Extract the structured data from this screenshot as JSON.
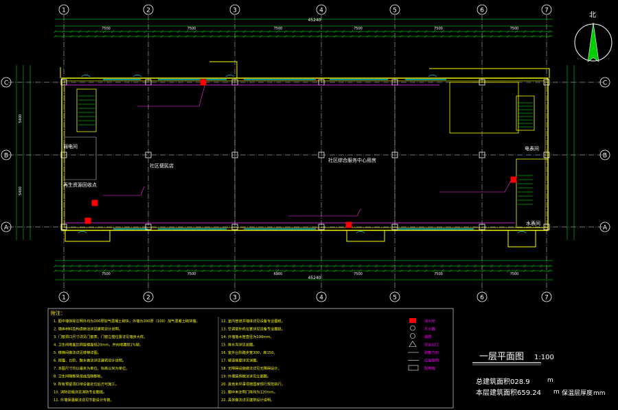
{
  "drawing": {
    "axis_numbers": [
      "1",
      "2",
      "3",
      "4",
      "5",
      "6",
      "7"
    ],
    "axis_letters": [
      "A",
      "B",
      "C"
    ],
    "north_label": "北",
    "total_width_dim": "45240",
    "top_dims": [
      "7500",
      "7500",
      "7500",
      "7500",
      "7500",
      "7500"
    ],
    "bottom_dims": [
      "7500",
      "7500",
      "6900",
      "7500",
      "7500",
      "7500"
    ],
    "left_dims": [
      "5400",
      "5400"
    ],
    "rooms": {
      "store": "社区便民店",
      "service_center": "社区综合服务中心用房",
      "well_room": "弱电间",
      "recycle_point": "再生资源回收点",
      "electric_room": "电表间",
      "meter_room": "水表间"
    }
  },
  "notes": {
    "header": "附注：",
    "left_column": [
      "1. 图中墙体除注明外均为200厚加气混凝土砌块，外墙为200厚（100）加气混凝土砌块墙。",
      "2. 墙体材料及构造做法详见建筑设计说明。",
      "3. 门窗洞口尺寸详见门窗表，门窗立樘位置详见墙身大样。",
      "4. 卫生间地面比同层楼面低20mm，并向地漏找1%坡。",
      "5. 楼梯间做法详见楼梯详图。",
      "6. 雨篷、台阶、散水做法详见建筑设计说明。",
      "7. 本图尺寸均以毫米为单位，标高以米为单位。",
      "8. 卫生间隔断采用成品隔断板。",
      "9. 所有预留洞口待设备定位后方可施工。",
      "10. 消防设施详见消防专业图纸。",
      "11. 外墙保温做法详见节能设计专篇。"
    ],
    "right_column": [
      "12. 室内管道井墙体详见设备专业图纸。",
      "13. 空调室外机位置详见设备专业图纸。",
      "14. 外墙落水管直径为100mm。",
      "15. 排水沟详见总图。",
      "16. 室外台阶踏步宽300，高150。",
      "17. 坡道坡度详见详图。",
      "18. 无障碍设施做法详见无障碍设计。",
      "19. 外墙装饰做法详见立面图。",
      "20. 其他未尽事项按国家现行规范执行。",
      "21. 图中未注明门垛均为120mm。",
      "22. 具体做法详见建筑设计说明。"
    ]
  },
  "legend": [
    {
      "symbol": "red-box",
      "label": "消火栓"
    },
    {
      "symbol": "fire-ext",
      "label": "灭火器"
    },
    {
      "symbol": "smoke",
      "label": "烟感"
    },
    {
      "symbol": "triangle",
      "label": "安全出口"
    },
    {
      "symbol": "line-a",
      "label": "疏散方向"
    },
    {
      "symbol": "line-b",
      "label": "应急照明"
    },
    {
      "symbol": "box-ab",
      "label": "配电箱"
    }
  ],
  "title_block": {
    "title": "一层平面图",
    "scale": "1:100",
    "area_total": "总建筑面积028.9",
    "area_total_unit": "m",
    "area_floor": "本层建筑面积659.24",
    "area_floor_unit": "m",
    "insulation": "保温层厚度",
    "insulation_unit": "mm"
  }
}
